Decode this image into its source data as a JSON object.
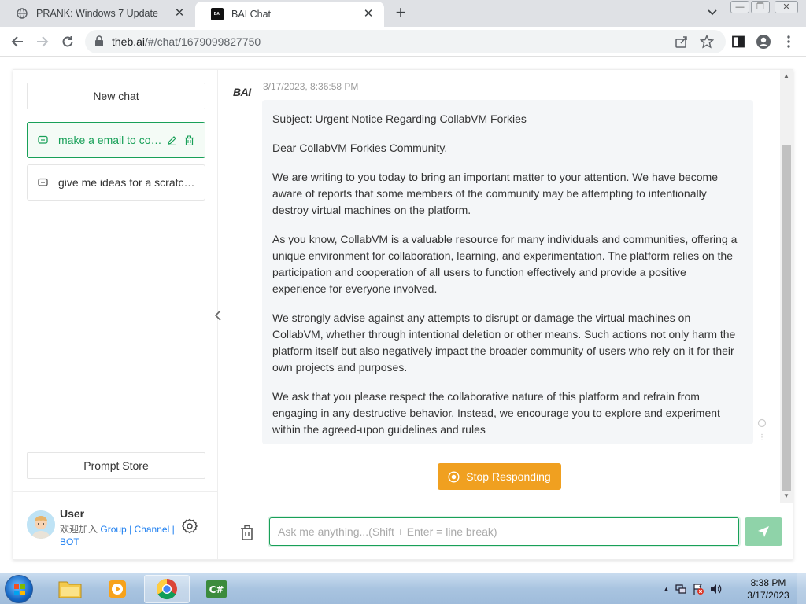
{
  "browser": {
    "tabs": [
      {
        "title": "PRANK: Windows 7 Update",
        "active": false
      },
      {
        "title": "BAI Chat",
        "active": true
      }
    ],
    "url_host": "theb.ai",
    "url_rest": "/#/chat/1679099827750"
  },
  "sidebar": {
    "new_chat": "New chat",
    "chats": [
      {
        "title": "make a email to col...",
        "active": true
      },
      {
        "title": "give me ideas for a scratch...",
        "active": false
      }
    ],
    "prompt_store": "Prompt Store",
    "user": {
      "name": "User",
      "welcome": "欢迎加入",
      "group": "Group",
      "sep1": "|",
      "channel": "Channel",
      "sep2": "|",
      "bot": "BOT"
    }
  },
  "chat": {
    "bot_name": "BAI",
    "timestamp": "3/17/2023, 8:36:58 PM",
    "paragraphs": [
      "Subject: Urgent Notice Regarding CollabVM Forkies",
      "Dear CollabVM Forkies Community,",
      "We are writing to you today to bring an important matter to your attention. We have become aware of reports that some members of the community may be attempting to intentionally destroy virtual machines on the platform.",
      "As you know, CollabVM is a valuable resource for many individuals and communities, offering a unique environment for collaboration, learning, and experimentation. The platform relies on the participation and cooperation of all users to function effectively and provide a positive experience for everyone involved.",
      "We strongly advise against any attempts to disrupt or damage the virtual machines on CollabVM, whether through intentional deletion or other means. Such actions not only harm the platform itself but also negatively impact the broader community of users who rely on it for their own projects and purposes.",
      "We ask that you please respect the collaborative nature of this platform and refrain from engaging in any destructive behavior. Instead, we encourage you to explore and experiment within the agreed-upon guidelines and rules"
    ],
    "stop_label": "Stop Responding",
    "input_placeholder": "Ask me anything...(Shift + Enter = line break)"
  },
  "taskbar": {
    "time": "8:38 PM",
    "date": "3/17/2023"
  },
  "colors": {
    "accent_green": "#18a058",
    "stop_orange": "#f0a020",
    "link_blue": "#2080f0"
  }
}
